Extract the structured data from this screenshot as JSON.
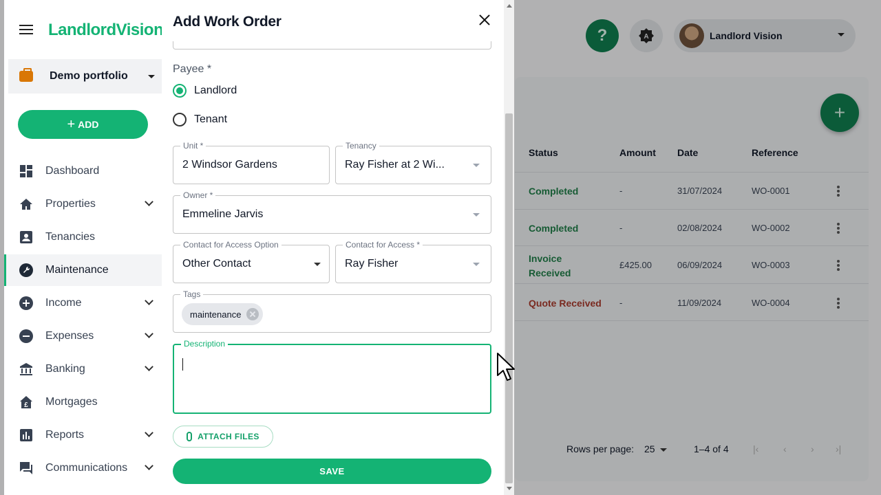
{
  "app": {
    "logo": "LandlordVision"
  },
  "header": {
    "help_label": "?",
    "theme_label": "A",
    "user_name": "Landlord Vision"
  },
  "sidebar": {
    "portfolio": "Demo portfolio",
    "add_label": "ADD",
    "items": [
      {
        "label": "Dashboard",
        "icon": "dashboard-icon",
        "expandable": false
      },
      {
        "label": "Properties",
        "icon": "home-icon",
        "expandable": true
      },
      {
        "label": "Tenancies",
        "icon": "contact-card-icon",
        "expandable": false
      },
      {
        "label": "Maintenance",
        "icon": "wrench-icon",
        "expandable": false,
        "active": true
      },
      {
        "label": "Income",
        "icon": "plus-circle-icon",
        "expandable": true
      },
      {
        "label": "Expenses",
        "icon": "minus-circle-icon",
        "expandable": true
      },
      {
        "label": "Banking",
        "icon": "bank-icon",
        "expandable": true
      },
      {
        "label": "Mortgages",
        "icon": "pound-house-icon",
        "expandable": false
      },
      {
        "label": "Reports",
        "icon": "bar-chart-icon",
        "expandable": true
      },
      {
        "label": "Communications",
        "icon": "chat-icon",
        "expandable": true
      }
    ]
  },
  "dialog": {
    "title": "Add Work Order",
    "payee_label": "Payee *",
    "payee_options": [
      "Landlord",
      "Tenant"
    ],
    "payee_selected": "Landlord",
    "unit": {
      "label": "Unit *",
      "value": "2 Windsor Gardens"
    },
    "tenancy": {
      "label": "Tenancy",
      "value": "Ray Fisher at 2 Wi..."
    },
    "owner": {
      "label": "Owner *",
      "value": "Emmeline Jarvis"
    },
    "contact_option": {
      "label": "Contact for Access Option",
      "value": "Other Contact"
    },
    "contact": {
      "label": "Contact for Access *",
      "value": "Ray Fisher"
    },
    "tags": {
      "label": "Tags",
      "chips": [
        "maintenance"
      ]
    },
    "description": {
      "label": "Description",
      "value": ""
    },
    "attach_label": "ATTACH FILES",
    "save_label": "SAVE"
  },
  "table": {
    "columns": [
      "Status",
      "Amount",
      "Date",
      "Reference"
    ],
    "rows": [
      {
        "status": "Completed",
        "status_color": "#1f7a46",
        "amount": "-",
        "date": "31/07/2024",
        "reference": "WO-0001"
      },
      {
        "status": "Completed",
        "status_color": "#1f7a46",
        "amount": "-",
        "date": "02/08/2024",
        "reference": "WO-0002"
      },
      {
        "status": "Invoice Received",
        "status_color": "#1f7a46",
        "amount": "£425.00",
        "date": "06/09/2024",
        "reference": "WO-0003"
      },
      {
        "status": "Quote Received",
        "status_color": "#a3392b",
        "amount": "-",
        "date": "11/09/2024",
        "reference": "WO-0004"
      }
    ],
    "rows_per_page_label": "Rows per page:",
    "rows_per_page": "25",
    "page_range": "1–4 of 4"
  },
  "colors": {
    "accent": "#14b374",
    "accent_dark": "#0f7a4d"
  }
}
